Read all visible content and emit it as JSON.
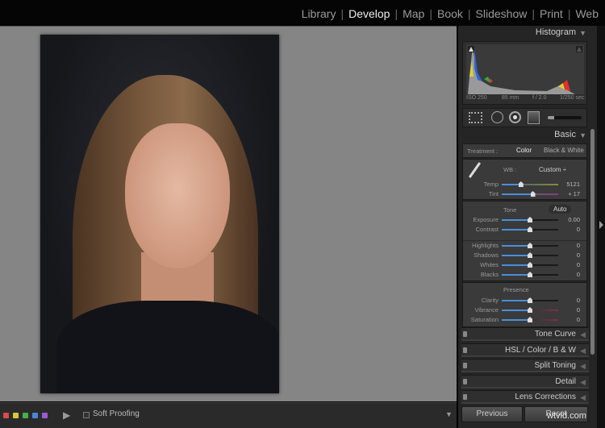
{
  "modules": [
    "Library",
    "Develop",
    "Map",
    "Book",
    "Slideshow",
    "Print",
    "Web"
  ],
  "active_module": "Develop",
  "histogram": {
    "title": "Histogram",
    "iso": "ISO 250",
    "focal": "85 mm",
    "aperture": "f / 2.0",
    "shutter": "1/250 sec"
  },
  "basic": {
    "title": "Basic",
    "treatment_label": "Treatment :",
    "treatment_color": "Color",
    "treatment_bw": "Black & White",
    "wb_label": "WB :",
    "wb_value": "Custom",
    "temp": {
      "label": "Temp",
      "value": "5121",
      "pos": 0.34
    },
    "tint": {
      "label": "Tint",
      "value": "+ 17",
      "pos": 0.55
    },
    "tone_label": "Tone",
    "auto_label": "Auto",
    "tone": [
      {
        "label": "Exposure",
        "value": "0.00"
      },
      {
        "label": "Contrast",
        "value": "0"
      }
    ],
    "tone2": [
      {
        "label": "Highlights",
        "value": "0"
      },
      {
        "label": "Shadows",
        "value": "0"
      },
      {
        "label": "Whites",
        "value": "0"
      },
      {
        "label": "Blacks",
        "value": "0"
      }
    ],
    "presence_label": "Presence",
    "presence": [
      {
        "label": "Clarity",
        "value": "0"
      },
      {
        "label": "Vibrance",
        "value": "0"
      },
      {
        "label": "Saturation",
        "value": "0"
      }
    ]
  },
  "sections": [
    "Tone Curve",
    "HSL / Color / B & W",
    "Split Toning",
    "Detail",
    "Lens Corrections"
  ],
  "buttons": {
    "previous": "Previous",
    "reset": "Reset"
  },
  "toolbar": {
    "soft_proofing": "Soft Proofing",
    "color_labels": [
      "#d94a4a",
      "#d6c937",
      "#4aae4a",
      "#4a86d6",
      "#9a5ad6"
    ]
  },
  "watermark": "wtvid.com"
}
